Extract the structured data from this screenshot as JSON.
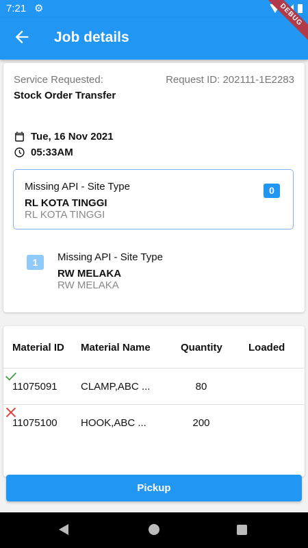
{
  "status_bar": {
    "time": "7:21",
    "icons": [
      "gear-icon",
      "wifi-icon",
      "signal-icon",
      "battery-icon"
    ],
    "debug_label": "DEBUG"
  },
  "app_bar": {
    "title": "Job details",
    "back_icon": "arrow-back-icon",
    "color": "#2196f3"
  },
  "job": {
    "service_label": "Service Requested:",
    "service_value": "Stock Order Transfer",
    "request_id": "Request ID: 202111-1E2283",
    "date": "Tue, 16 Nov 2021",
    "time": "05:33AM"
  },
  "sites": [
    {
      "index": "0",
      "title": "Missing API - Site Type",
      "name": "RL KOTA TINGGI",
      "sub": "RL KOTA TINGGI",
      "selected": true
    },
    {
      "index": "1",
      "title": "Missing API - Site Type",
      "name": "RW MELAKA",
      "sub": "RW MELAKA",
      "selected": false
    }
  ],
  "materials": {
    "headers": [
      "Material ID",
      "Material Name",
      "Quantity",
      "Loaded"
    ],
    "rows": [
      {
        "id": "11075091",
        "name": "CLAMP,ABC ...",
        "quantity": "80",
        "loaded": true,
        "loaded_icon": "check-icon",
        "color": "#43a047"
      },
      {
        "id": "11075100",
        "name": "HOOK,ABC ...",
        "quantity": "200",
        "loaded": false,
        "loaded_icon": "cross-icon",
        "color": "#e53935"
      }
    ]
  },
  "pickup_button": {
    "label": "Pickup"
  },
  "nav_bar": {
    "icons": [
      "nav-back-icon",
      "nav-home-icon",
      "nav-recents-icon"
    ]
  }
}
